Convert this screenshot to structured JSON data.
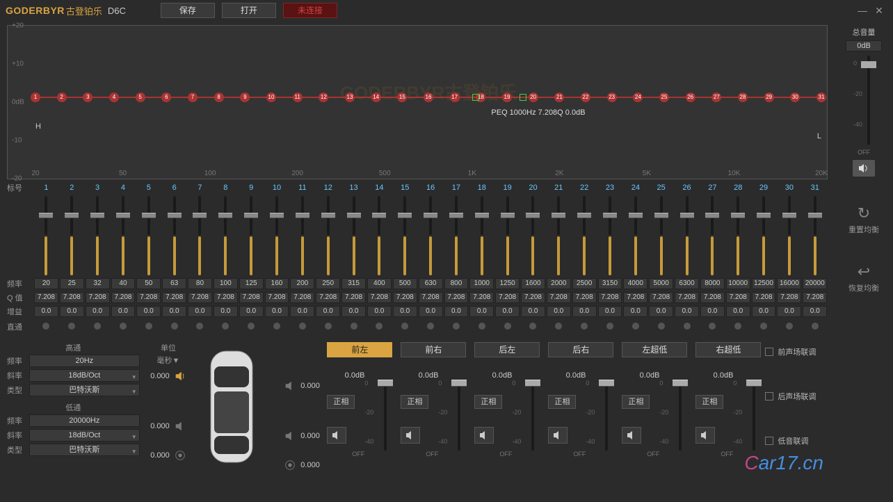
{
  "title": {
    "brand_en": "GODERBYR",
    "brand_cn": "古登铂乐",
    "model": "D6C"
  },
  "toolbar": {
    "save": "保存",
    "open": "打开",
    "disconnect": "未连接"
  },
  "window": {
    "minimize": "—",
    "close": "✕"
  },
  "graph": {
    "y_ticks": [
      "+20",
      "+10",
      "0dB",
      "-10",
      "-20"
    ],
    "x_ticks": [
      "20",
      "50",
      "100",
      "200",
      "500",
      "1K",
      "2K",
      "5K",
      "10K",
      "20K"
    ],
    "peq_info": "PEQ 1000Hz 7.208Q 0.0dB",
    "watermark": "GODERBYR古登铂乐",
    "h_mark": "H",
    "l_mark": "L"
  },
  "eq": {
    "label_band": "标号",
    "label_freq": "频率",
    "label_q": "Q 值",
    "label_gain": "增益",
    "label_bypass": "直通",
    "bands": [
      1,
      2,
      3,
      4,
      5,
      6,
      7,
      8,
      9,
      10,
      11,
      12,
      13,
      14,
      15,
      16,
      17,
      18,
      19,
      20,
      21,
      22,
      23,
      24,
      25,
      26,
      27,
      28,
      29,
      30,
      31
    ],
    "freq": [
      "20",
      "25",
      "32",
      "40",
      "50",
      "63",
      "80",
      "100",
      "125",
      "160",
      "200",
      "250",
      "315",
      "400",
      "500",
      "630",
      "800",
      "1000",
      "1250",
      "1600",
      "2000",
      "2500",
      "3150",
      "4000",
      "5000",
      "6300",
      "8000",
      "10000",
      "12500",
      "16000",
      "20000"
    ],
    "q": [
      "7.208",
      "7.208",
      "7.208",
      "7.208",
      "7.208",
      "7.208",
      "7.208",
      "7.208",
      "7.208",
      "7.208",
      "7.208",
      "7.208",
      "7.208",
      "7.208",
      "7.208",
      "7.208",
      "7.208",
      "7.208",
      "7.208",
      "7.208",
      "7.208",
      "7.208",
      "7.208",
      "7.208",
      "7.208",
      "7.208",
      "7.208",
      "7.208",
      "7.208",
      "7.208",
      "7.208"
    ],
    "gain": [
      "0.0",
      "0.0",
      "0.0",
      "0.0",
      "0.0",
      "0.0",
      "0.0",
      "0.0",
      "0.0",
      "0.0",
      "0.0",
      "0.0",
      "0.0",
      "0.0",
      "0.0",
      "0.0",
      "0.0",
      "0.0",
      "0.0",
      "0.0",
      "0.0",
      "0.0",
      "0.0",
      "0.0",
      "0.0",
      "0.0",
      "0.0",
      "0.0",
      "0.0",
      "0.0",
      "0.0"
    ]
  },
  "filter": {
    "hp_title": "高通",
    "lp_title": "低通",
    "freq_label": "频率",
    "slope_label": "斜率",
    "type_label": "类型",
    "hp_freq": "20Hz",
    "hp_slope": "18dB/Oct",
    "hp_type": "巴特沃斯",
    "lp_freq": "20000Hz",
    "lp_slope": "18dB/Oct",
    "lp_type": "巴特沃斯"
  },
  "delay": {
    "unit_title": "单位",
    "unit_value": "毫秒",
    "values": [
      "0.000",
      "0.000",
      "0.000",
      "0.000",
      "0.000",
      "0.000"
    ]
  },
  "channels": {
    "list": [
      {
        "name": "前左",
        "active": true
      },
      {
        "name": "前右",
        "active": false
      },
      {
        "name": "后左",
        "active": false
      },
      {
        "name": "后右",
        "active": false
      },
      {
        "name": "左超低",
        "active": false
      },
      {
        "name": "右超低",
        "active": false
      }
    ],
    "db_label": "0.0dB",
    "phase": "正相",
    "scale": [
      "0",
      "-20",
      "-40"
    ],
    "off": "OFF"
  },
  "links": {
    "front": "前声场联调",
    "rear": "后声场联调",
    "sub": "低音联调"
  },
  "master": {
    "title": "总音量",
    "db": "0dB",
    "scale": [
      "0",
      "-20",
      "-40"
    ],
    "off": "OFF"
  },
  "side": {
    "reset": "重置均衡",
    "restore": "恢复均衡"
  },
  "watermark": {
    "c": "C",
    "rest": "ar17.cn"
  }
}
